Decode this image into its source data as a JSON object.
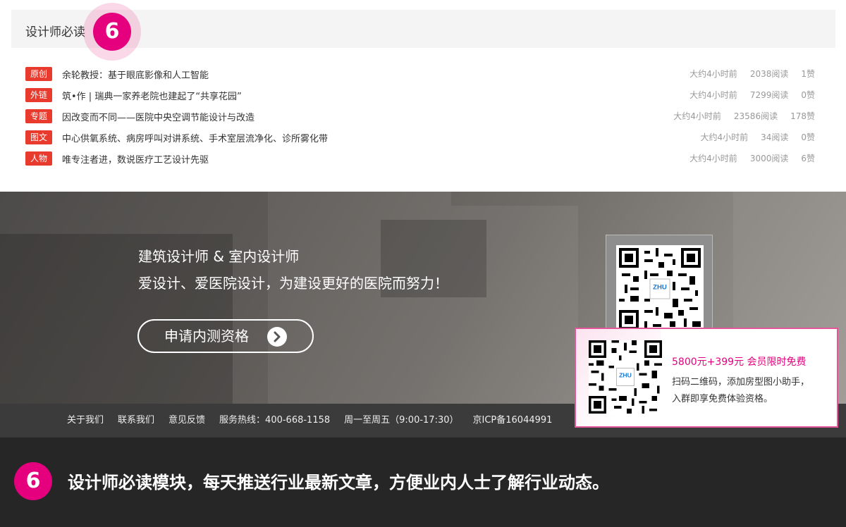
{
  "section": {
    "title": "设计师必读",
    "step_number": "6"
  },
  "articles": [
    {
      "tag": "原创",
      "title": "余轮教授：基于眼底影像和人工智能",
      "time": "大约4小时前",
      "reads": "2038阅读",
      "likes": "1赞"
    },
    {
      "tag": "外链",
      "title": "筑•作 | 瑞典一家养老院也建起了“共享花园”",
      "time": "大约4小时前",
      "reads": "7299阅读",
      "likes": "0赞"
    },
    {
      "tag": "专题",
      "title": "因改变而不同——医院中央空调节能设计与改造",
      "time": "大约4小时前",
      "reads": "23586阅读",
      "likes": "178赞"
    },
    {
      "tag": "图文",
      "title": "中心供氧系统、病房呼叫对讲系统、手术室层流净化、诊所雾化带",
      "time": "大约4小时前",
      "reads": "34阅读",
      "likes": "0赞"
    },
    {
      "tag": "人物",
      "title": "唯专注者进，数说医疗工艺设计先驱",
      "time": "大约4小时前",
      "reads": "3000阅读",
      "likes": "6赞"
    }
  ],
  "hero": {
    "line1": "建筑设计师 & 室内设计师",
    "line2": "爱设计、爱医院设计，为建设更好的医院而努力！",
    "button_label": "申请内测资格"
  },
  "footer": {
    "about": "关于我们",
    "contact": "联系我们",
    "feedback": "意见反馈",
    "hotline": "服务热线：400-668-1158",
    "hours": "周一至周五（9:00-17:30）",
    "icp": "京ICP备16044991"
  },
  "popup": {
    "price": "5800元+399元 会员限时免费",
    "text1": "扫码二维码，添加房型图小助手，",
    "text2": "入群即享免费体验资格。"
  },
  "caption": {
    "step_number": "6",
    "text": "设计师必读模块，每天推送行业最新文章，方便业内人士了解行业动态。"
  },
  "colors": {
    "accent_pink": "#e5007e",
    "tag_red": "#e83b2e",
    "caption_bg": "#262626"
  }
}
